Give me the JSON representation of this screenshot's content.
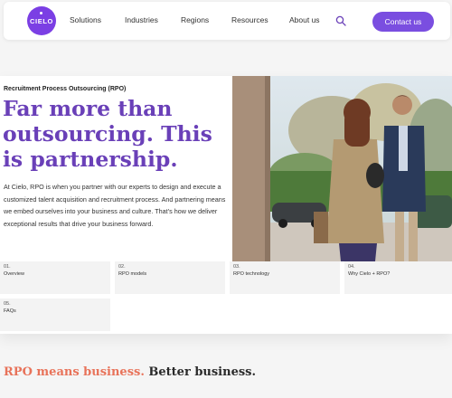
{
  "nav": {
    "logo_text": "CIELO",
    "items": [
      "Solutions",
      "Industries",
      "Regions",
      "Resources",
      "About us"
    ],
    "contact_label": "Contact us"
  },
  "hero": {
    "eyebrow": "Recruitment Process Outsourcing (RPO)",
    "headline": "Far more than outsourcing. This is partnership.",
    "body": "At Cielo, RPO is when you partner with our experts to design and execute a customized talent acquisition and recruitment process. And partnering means we embed ourselves into your business and culture. That’s how we deliver exceptional results that drive your business forward."
  },
  "tabs": [
    {
      "num": "01.",
      "label": "Overview"
    },
    {
      "num": "02.",
      "label": "RPO models"
    },
    {
      "num": "03.",
      "label": "RPO technology"
    },
    {
      "num": "04.",
      "label": "Why Cielo + RPO?"
    },
    {
      "num": "05.",
      "label": "FAQs"
    }
  ],
  "section": {
    "title_accent": "RPO means business.",
    "title_rest": "Better business."
  },
  "colors": {
    "brand_purple": "#7b3fe4",
    "headline_purple": "#6a40b8",
    "accent_coral": "#e8735a"
  },
  "icons": [
    "search-icon"
  ]
}
